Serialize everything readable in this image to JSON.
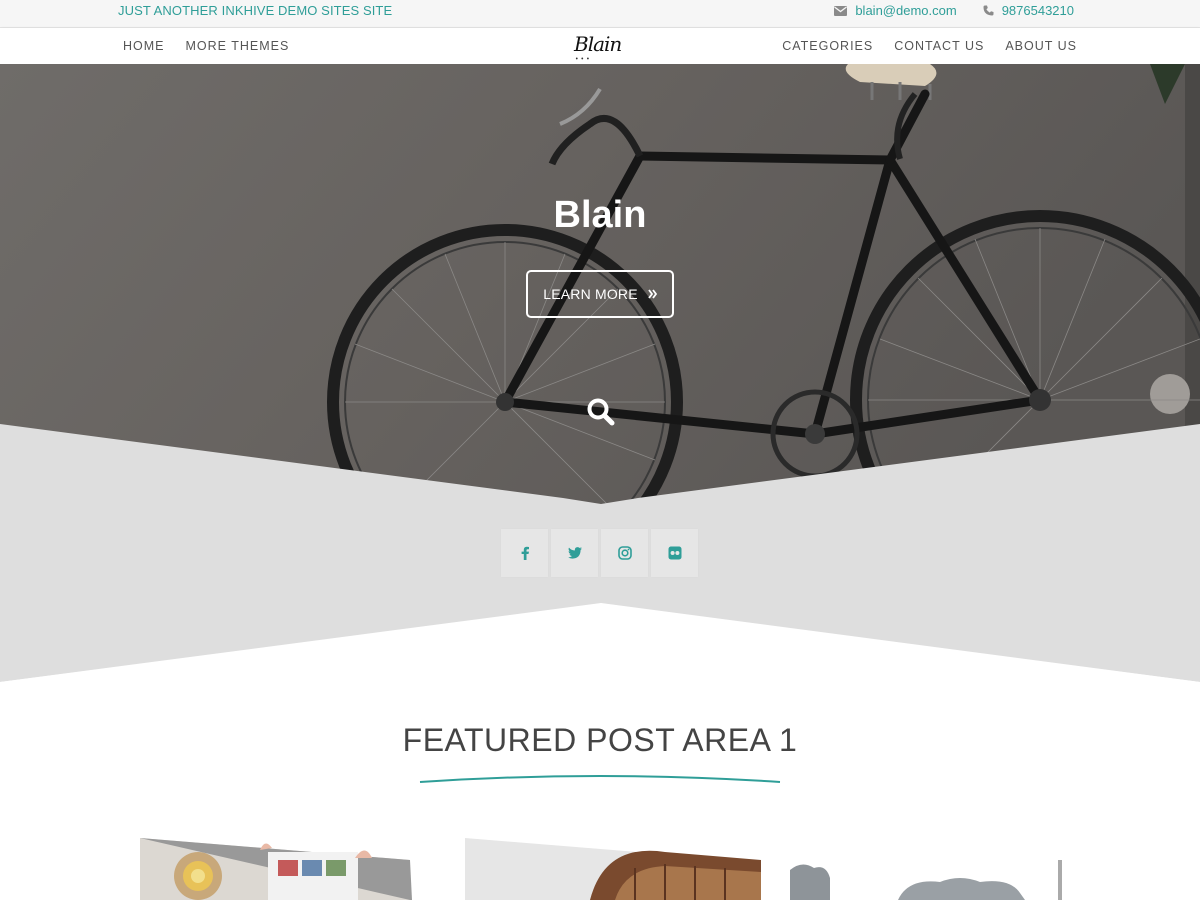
{
  "topbar": {
    "tagline": "JUST ANOTHER INKHIVE DEMO SITES SITE",
    "email": "blain@demo.com",
    "phone": "9876543210",
    "email_icon": "envelope-icon",
    "phone_icon": "phone-icon"
  },
  "nav": {
    "left": [
      "HOME",
      "MORE THEMES"
    ],
    "right": [
      "CATEGORIES",
      "CONTACT US",
      "ABOUT US"
    ],
    "logo": "Blain"
  },
  "hero": {
    "title": "Blain",
    "button_label": "LEARN MORE",
    "button_icon": "double-chevron-right-icon",
    "search_icon": "search-icon"
  },
  "social": [
    {
      "name": "facebook-icon"
    },
    {
      "name": "twitter-icon"
    },
    {
      "name": "instagram-icon"
    },
    {
      "name": "flickr-icon"
    }
  ],
  "featured": {
    "title": "FEATURED POST AREA 1"
  },
  "colors": {
    "accent": "#2f9e98",
    "band": "#dedede",
    "nav_text": "#555555"
  }
}
